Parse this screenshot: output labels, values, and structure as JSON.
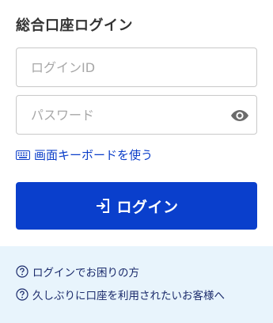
{
  "login": {
    "title": "総合口座ログイン",
    "id_field": {
      "placeholder": "ログインID",
      "value": ""
    },
    "password_field": {
      "placeholder": "パスワード",
      "value": ""
    },
    "password_toggle_icon": "eye-icon",
    "screen_keyboard": {
      "label": "画面キーボードを使う",
      "icon": "keyboard-icon"
    },
    "submit": {
      "label": "ログイン",
      "icon": "login-enter-icon"
    }
  },
  "help": {
    "links": [
      {
        "label": "ログインでお困りの方",
        "icon": "question-circle-icon"
      },
      {
        "label": "久しぶりに口座を利用されたいお客様へ",
        "icon": "question-circle-icon"
      }
    ]
  },
  "colors": {
    "accent": "#0a3fcc",
    "link": "#0b3ec9",
    "help_background": "#e8f4fc",
    "help_text": "#1a2a6b",
    "title_text": "#333333"
  }
}
